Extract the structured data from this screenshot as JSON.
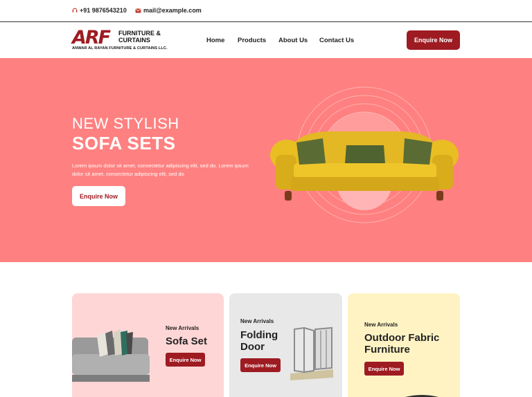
{
  "topbar": {
    "phone": "+91 9876543210",
    "email": "mail@example.com",
    "icons": [
      "headset-icon",
      "mail-icon"
    ]
  },
  "brand": {
    "mark": "ARF",
    "line1": "FURNITURE &",
    "line2": "CURTAINS",
    "tagline": "ANWAR AL RAYAN FURNITURE & CURTAINS LLC."
  },
  "nav": {
    "items": [
      {
        "label": "Home"
      },
      {
        "label": "Products"
      },
      {
        "label": "About Us"
      },
      {
        "label": "Contact Us"
      }
    ],
    "cta": "Enquire Now"
  },
  "hero": {
    "line1": "NEW STYLISH",
    "line2": "SOFA SETS",
    "lead": "Lorem ipsum dolor sit amet, consectetur adipiscing elit, sed do. Lorem ipsum dolor sit amet, consectetur adipiscing elit, sed do",
    "cta": "Enquire Now",
    "image": "yellow-sofa"
  },
  "cards": [
    {
      "kicker": "New Arrivals",
      "title": "Sofa Set",
      "cta": "Enquire Now",
      "image": "grey-sofa"
    },
    {
      "kicker": "New Arrivals",
      "title": "Folding Door",
      "cta": "Enquire Now",
      "image": "folding-door"
    },
    {
      "kicker": "New Arrivals",
      "title": "Outdoor Fabric Furniture",
      "cta": "Enquire Now",
      "image": "outdoor-chair"
    }
  ],
  "colors": {
    "brand_red": "#9e1b22",
    "hero_bg": "#ff8080",
    "card1_bg": "#ffd6d6",
    "card2_bg": "#e8e8e8",
    "card3_bg": "#fff3c4"
  }
}
